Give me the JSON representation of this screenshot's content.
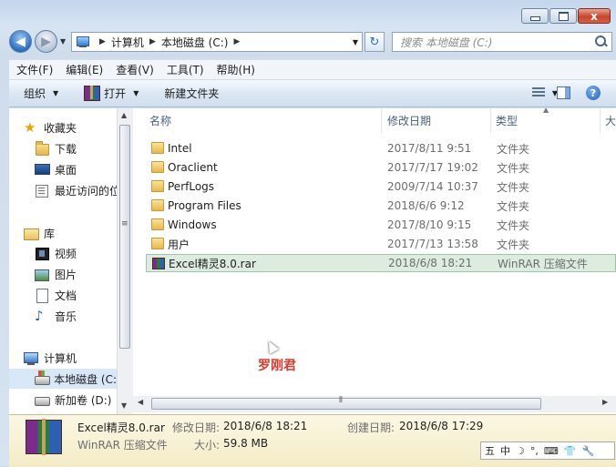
{
  "window": {
    "min_icon": "minimize-icon",
    "max_icon": "maximize-icon",
    "close_label": "x"
  },
  "address": {
    "crumbs": [
      "计算机",
      "本地磁盘 (C:)"
    ],
    "search_placeholder": "搜索 本地磁盘 (C:)"
  },
  "menu": [
    "文件(F)",
    "编辑(E)",
    "查看(V)",
    "工具(T)",
    "帮助(H)"
  ],
  "toolbar": {
    "organize": "组织",
    "open": "打开",
    "new_folder": "新建文件夹",
    "help": "?"
  },
  "nav": {
    "favorites": "收藏夹",
    "downloads": "下载",
    "desktop": "桌面",
    "recent": "最近访问的位",
    "libraries": "库",
    "videos": "视频",
    "pictures": "图片",
    "documents": "文档",
    "music": "音乐",
    "computer": "计算机",
    "drive_c": "本地磁盘 (C:",
    "drive_d": "新加卷 (D:)"
  },
  "columns": {
    "name": "名称",
    "date": "修改日期",
    "type": "类型",
    "size": "大"
  },
  "files": [
    {
      "name": "Intel",
      "date": "2017/8/11 9:51",
      "type": "文件夹",
      "icon": "folder-icon"
    },
    {
      "name": "Oraclient",
      "date": "2017/7/17 19:02",
      "type": "文件夹",
      "icon": "folder-icon"
    },
    {
      "name": "PerfLogs",
      "date": "2009/7/14 10:37",
      "type": "文件夹",
      "icon": "folder-icon"
    },
    {
      "name": "Program Files",
      "date": "2018/6/6 9:12",
      "type": "文件夹",
      "icon": "folder-icon"
    },
    {
      "name": "Windows",
      "date": "2017/8/10 9:15",
      "type": "文件夹",
      "icon": "folder-icon"
    },
    {
      "name": "用户",
      "date": "2017/7/13 13:58",
      "type": "文件夹",
      "icon": "folder-icon"
    },
    {
      "name": "Excel精灵8.0.rar",
      "date": "2018/6/8 18:21",
      "type": "WinRAR 压缩文件",
      "icon": "winrar-icon"
    }
  ],
  "watermark": "罗刚君",
  "details": {
    "filename": "Excel精灵8.0.rar",
    "modified_label": "修改日期:",
    "modified_value": "2018/6/8 18:21",
    "created_label": "创建日期:",
    "created_value": "2018/6/8 17:29",
    "type": "WinRAR 压缩文件",
    "size_label": "大小:",
    "size_value": "59.8 MB"
  },
  "ime": [
    "五",
    "中",
    "☽",
    "°,",
    "⌨",
    "👕",
    "🔧"
  ]
}
